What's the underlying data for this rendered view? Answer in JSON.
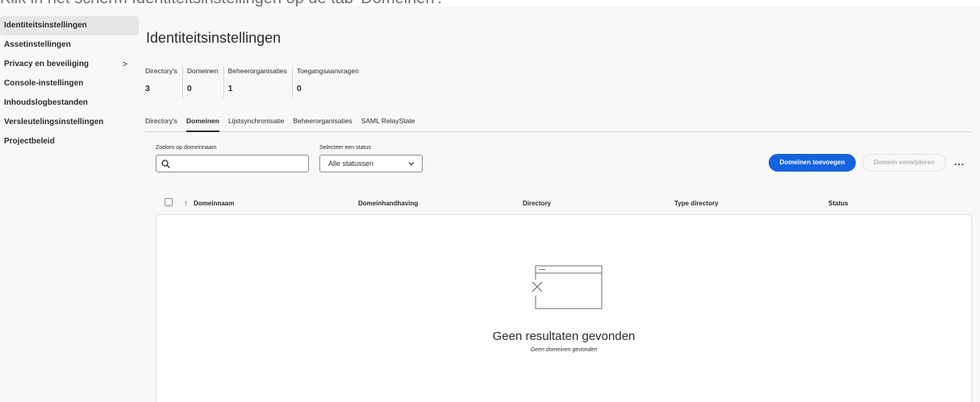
{
  "instruction": "Klik in het scherm Identiteitsinstellingen op de tab 'Domeinen'.",
  "sidebar": {
    "items": [
      {
        "label": "Identiteitsinstellingen"
      },
      {
        "label": "Assetinstellingen"
      },
      {
        "label": "Privacy en beveiliging",
        "chevron": ">"
      },
      {
        "label": "Console-instellingen"
      },
      {
        "label": "Inhoudslogbestanden"
      },
      {
        "label": "Versleutelingsinstellingen"
      },
      {
        "label": "Projectbeleid"
      }
    ],
    "active_index": 0
  },
  "page": {
    "title": "Identiteitsinstellingen"
  },
  "stats": [
    {
      "label": "Directory's",
      "value": "3"
    },
    {
      "label": "Domeinen",
      "value": "0"
    },
    {
      "label": "Beheerorganisaties",
      "value": "1"
    },
    {
      "label": "Toegangsaanvragen",
      "value": "0"
    }
  ],
  "tabs": [
    {
      "label": "Directory's"
    },
    {
      "label": "Domeinen",
      "active": true
    },
    {
      "label": "Lijstsynchronisatie"
    },
    {
      "label": "Beheerorganisaties"
    },
    {
      "label": "SAML RelayState"
    }
  ],
  "filters": {
    "search_label": "Zoeken op domeinnaam",
    "search_value": "",
    "status_label": "Selecteer een status",
    "status_value": "Alle statussen"
  },
  "actions": {
    "add": "Domeinen toevoegen",
    "remove": "Domein verwijderen",
    "more": "..."
  },
  "table": {
    "sort_icon": "↑",
    "columns": [
      "Domeinnaam",
      "Domeinhandhaving",
      "Directory",
      "Type directory",
      "Status"
    ],
    "empty_title": "Geen resultaten gevonden",
    "empty_subtitle": "Geen domeinen gevonden"
  },
  "colors": {
    "primary": "#1463e0",
    "background": "#f8f8f8"
  }
}
